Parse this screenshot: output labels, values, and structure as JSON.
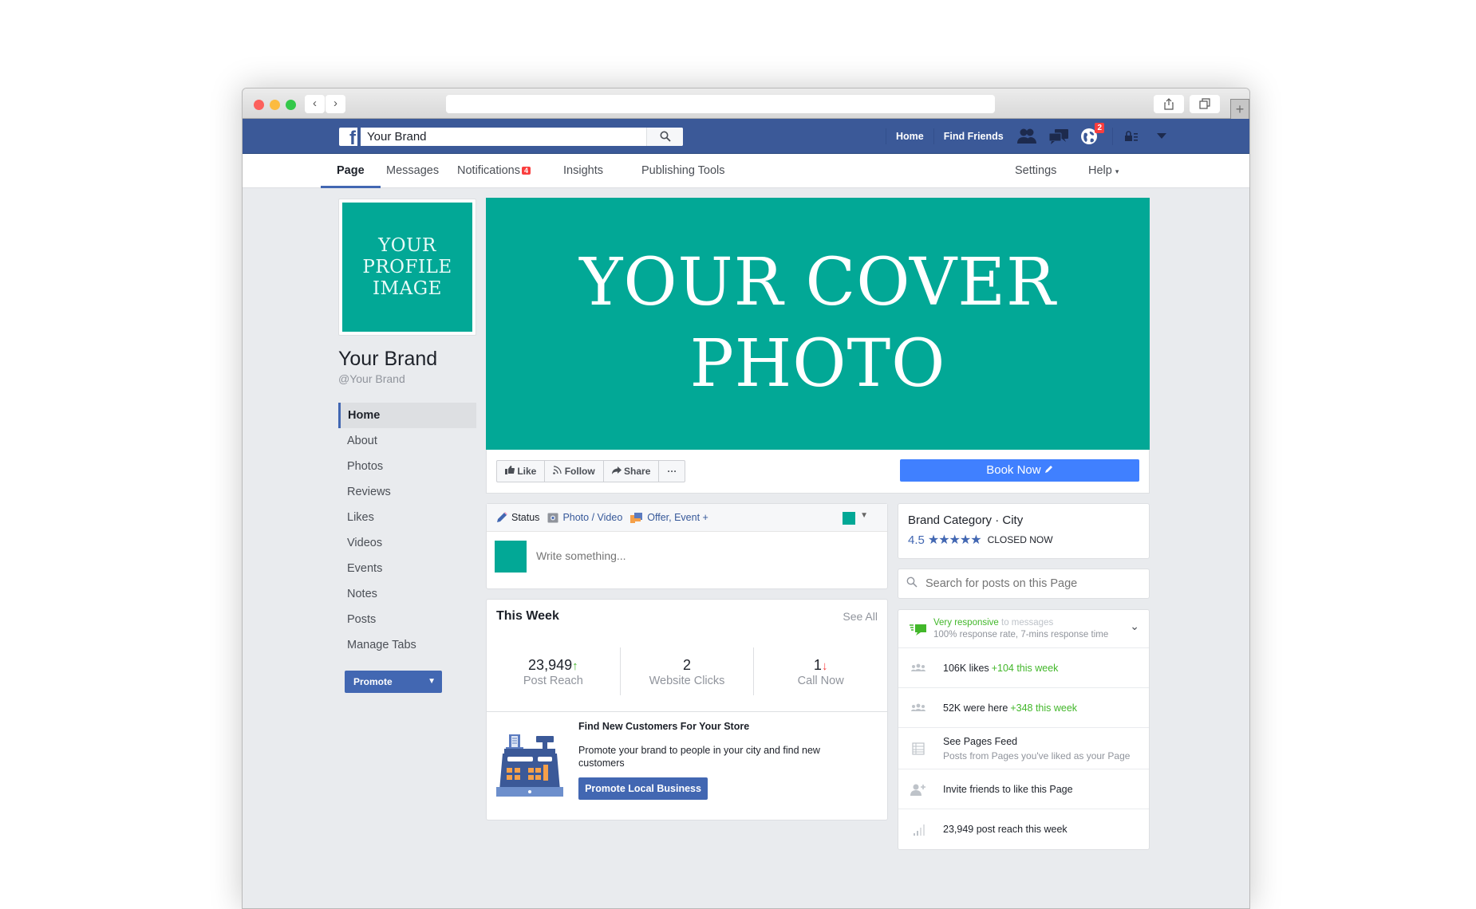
{
  "browser": {
    "back_icon": "‹",
    "forward_icon": "›",
    "share_icon": "⇪",
    "tabs_icon": "⧉",
    "new_tab_icon": "+"
  },
  "header": {
    "logo": "f",
    "search_value": "Your Brand",
    "links": [
      "Home",
      "Find Friends"
    ],
    "notifications_badge": "2"
  },
  "page_tabs": {
    "items": [
      {
        "label": "Page",
        "active": true
      },
      {
        "label": "Messages"
      },
      {
        "label": "Notifications",
        "badge": "4"
      },
      {
        "label": "Insights"
      },
      {
        "label": "Publishing Tools"
      }
    ],
    "right": [
      {
        "label": "Settings"
      },
      {
        "label": "Help",
        "caret": "▾"
      }
    ]
  },
  "profile": {
    "image_text": "YOUR\nPROFILE\nIMAGE",
    "name": "Your Brand",
    "handle": "@Your Brand",
    "accent": "#02a896"
  },
  "sidenav": {
    "items": [
      "Home",
      "About",
      "Photos",
      "Reviews",
      "Likes",
      "Videos",
      "Events",
      "Notes",
      "Posts",
      "Manage Tabs"
    ],
    "active": "Home",
    "promote_label": "Promote"
  },
  "cover": {
    "text": "YOUR COVER\nPHOTO"
  },
  "actions": {
    "like": "Like",
    "follow": "Follow",
    "share": "Share",
    "more": "···",
    "book_now": "Book Now"
  },
  "composer": {
    "tabs": [
      "Status",
      "Photo / Video",
      "Offer, Event +"
    ],
    "placeholder": "Write something..."
  },
  "this_week": {
    "title": "This Week",
    "see_all": "See All",
    "stats": [
      {
        "value": "23,949",
        "label": "Post Reach",
        "trend": "up"
      },
      {
        "value": "2",
        "label": "Website Clicks",
        "trend": "none"
      },
      {
        "value": "1",
        "label": "Call Now",
        "trend": "down"
      }
    ],
    "promo": {
      "title": "Find New Customers For Your Store",
      "text": "Promote your brand to people in your city and find new customers",
      "button": "Promote Local Business"
    }
  },
  "about_card": {
    "category": "Brand Category · City",
    "rating": "4.5",
    "stars": "★★★★★",
    "status": "CLOSED NOW"
  },
  "page_search": {
    "placeholder": "Search for posts on this Page"
  },
  "info_list": {
    "responsive_highlight": "Very responsive",
    "responsive_rest": " to messages",
    "responsive_detail": "100% response rate, 7-mins response time",
    "likes_text": "106K likes ",
    "likes_delta": "+104 this week",
    "checkins_text": "52K were here ",
    "checkins_delta": "+348 this week",
    "feed_title": "See Pages Feed",
    "feed_sub": "Posts from Pages you've liked as your Page",
    "invite": "Invite friends to like this Page",
    "reach": "23,949 post reach this week"
  }
}
